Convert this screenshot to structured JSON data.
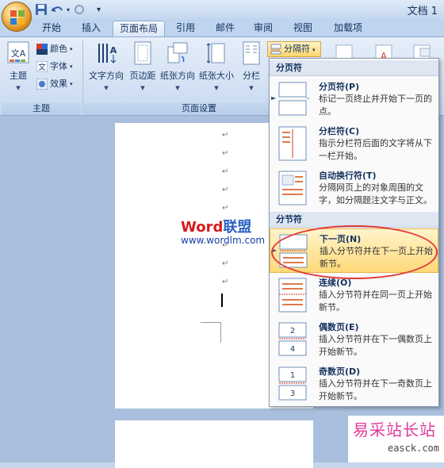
{
  "window": {
    "title": "文档 1"
  },
  "tabs": [
    "开始",
    "插入",
    "页面布局",
    "引用",
    "邮件",
    "审阅",
    "视图",
    "加载项"
  ],
  "active_tab": "页面布局",
  "ribbon": {
    "theme_group": {
      "label": "主题",
      "theme_button": "主题",
      "colors": "颜色",
      "fonts": "字体",
      "effects": "效果"
    },
    "page_setup_group": {
      "label": "页面设置",
      "text_direction": "文字方向",
      "margins": "页边距",
      "orientation": "纸张方向",
      "size": "纸张大小",
      "columns": "分栏",
      "breaks": "分隔符"
    }
  },
  "breaks_menu": {
    "page_breaks_header": "分页符",
    "section_breaks_header": "分节符",
    "items": [
      {
        "title": "分页符(P)",
        "desc": "标记一页终止并开始下一页的点。"
      },
      {
        "title": "分栏符(C)",
        "desc": "指示分栏符后面的文字将从下一栏开始。"
      },
      {
        "title": "自动换行符(T)",
        "desc": "分隔网页上的对象周围的文字，如分隔题注文字与正文。"
      },
      {
        "title": "下一页(N)",
        "desc": "插入分节符并在下一页上开始新节。",
        "highlighted": true
      },
      {
        "title": "连续(O)",
        "desc": "插入分节符并在同一页上开始新节。"
      },
      {
        "title": "偶数页(E)",
        "desc": "插入分节符并在下一偶数页上开始新节。"
      },
      {
        "title": "奇数页(D)",
        "desc": "插入分节符并在下一奇数页上开始新节。"
      }
    ]
  },
  "document": {
    "paragraph_mark": "↵",
    "wordmark": {
      "word": "Word",
      "cn": "联盟",
      "url": "www.wordlm.com"
    }
  },
  "watermark": {
    "cn": "易采站长站",
    "en": "easck.com"
  },
  "colors": {
    "accent_highlight": "#ffd978",
    "annotation": "#e23a3a",
    "ribbon": "#d4e2f3"
  }
}
